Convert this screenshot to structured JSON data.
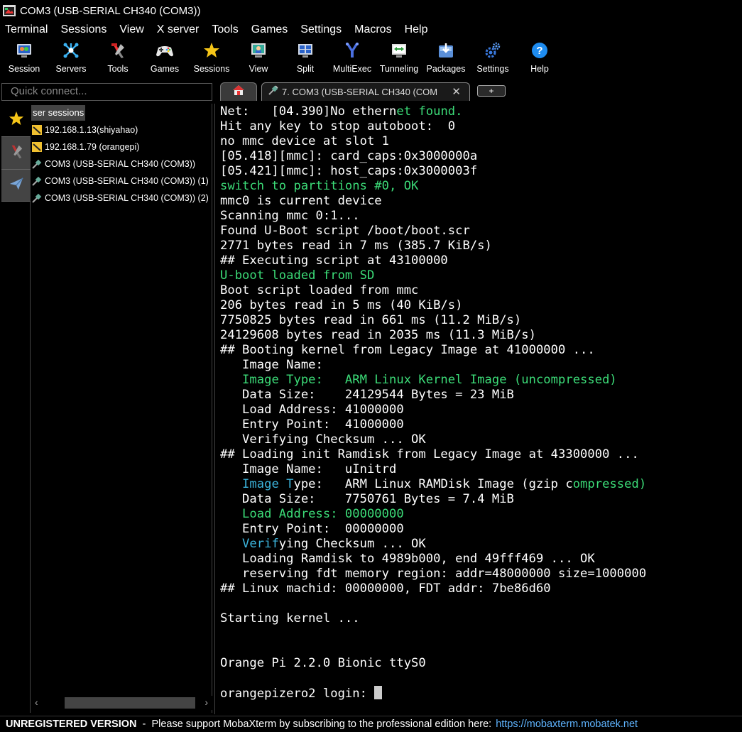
{
  "window": {
    "title": "COM3  (USB-SERIAL CH340 (COM3))"
  },
  "menu": [
    "Terminal",
    "Sessions",
    "View",
    "X server",
    "Tools",
    "Games",
    "Settings",
    "Macros",
    "Help"
  ],
  "toolbar": [
    {
      "label": "Session",
      "icon": "session-icon"
    },
    {
      "label": "Servers",
      "icon": "servers-icon"
    },
    {
      "label": "Tools",
      "icon": "tools-icon"
    },
    {
      "label": "Games",
      "icon": "gamepad-icon"
    },
    {
      "label": "Sessions",
      "icon": "star-icon"
    },
    {
      "label": "View",
      "icon": "view-icon"
    },
    {
      "label": "Split",
      "icon": "split-icon"
    },
    {
      "label": "MultiExec",
      "icon": "multiexec-icon"
    },
    {
      "label": "Tunneling",
      "icon": "tunneling-icon"
    },
    {
      "label": "Packages",
      "icon": "packages-icon"
    },
    {
      "label": "Settings",
      "icon": "settings-icon"
    },
    {
      "label": "Help",
      "icon": "help-icon"
    }
  ],
  "quick_connect": {
    "placeholder": "Quick connect..."
  },
  "tabs": {
    "active_label": "7. COM3  (USB-SERIAL CH340 (COM",
    "close": "✕",
    "add": "+"
  },
  "sessions_panel": {
    "header": "ser sessions",
    "items": [
      {
        "label": "192.168.1.13(shiyahao)",
        "icon": "ssh-session-icon"
      },
      {
        "label": "192.168.1.79 (orangepi)",
        "icon": "ssh-session-icon"
      },
      {
        "label": "COM3  (USB-SERIAL CH340 (COM3))",
        "icon": "serial-session-icon"
      },
      {
        "label": "COM3  (USB-SERIAL CH340 (COM3)) (1)",
        "icon": "serial-session-icon"
      },
      {
        "label": "COM3  (USB-SERIAL CH340 (COM3)) (2)",
        "icon": "serial-session-icon"
      }
    ]
  },
  "terminal_lines": [
    [
      [
        "Net:   [04.390]No ethern",
        ""
      ],
      [
        "et found.",
        "g"
      ]
    ],
    [
      [
        "Hit any key to stop autoboot:  0",
        ""
      ]
    ],
    [
      [
        "no mmc device at slot 1",
        ""
      ]
    ],
    [
      [
        "[05.418][mmc]: card_caps:0x3000000a",
        ""
      ]
    ],
    [
      [
        "[05.421][mmc]: host_caps:0x3000003f",
        ""
      ]
    ],
    [
      [
        "switch to partitions #0, OK",
        "g"
      ]
    ],
    [
      [
        "mmc0 is current device",
        ""
      ]
    ],
    [
      [
        "Scanning mmc 0:1...",
        ""
      ]
    ],
    [
      [
        "Found U-Boot script /boot/boot.scr",
        ""
      ]
    ],
    [
      [
        "2771 bytes read in 7 ms (385.7 KiB/s)",
        ""
      ]
    ],
    [
      [
        "## Executing script at 43100000",
        ""
      ]
    ],
    [
      [
        "U-boot loaded from SD",
        "g"
      ]
    ],
    [
      [
        "Boot script loaded from mmc",
        ""
      ]
    ],
    [
      [
        "206 bytes read in 5 ms (40 KiB/s)",
        ""
      ]
    ],
    [
      [
        "7750825 bytes read in 661 ms (11.2 MiB/s)",
        ""
      ]
    ],
    [
      [
        "24129608 bytes read in 2035 ms (11.3 MiB/s)",
        ""
      ]
    ],
    [
      [
        "## Booting kernel from Legacy Image at 41000000 ...",
        ""
      ]
    ],
    [
      [
        "   Image Name:",
        ""
      ]
    ],
    [
      [
        "   ",
        ""
      ],
      [
        "Image Type:   ARM Linux Kernel Image (uncompressed)",
        "g"
      ]
    ],
    [
      [
        "   Data Size:    24129544 Bytes = 23 MiB",
        ""
      ]
    ],
    [
      [
        "   Load Address: 41000000",
        ""
      ]
    ],
    [
      [
        "   Entry Point:  41000000",
        ""
      ]
    ],
    [
      [
        "   Verifying Checksum ... OK",
        ""
      ]
    ],
    [
      [
        "## Loading init Ramdisk from Legacy Image at 43300000 ...",
        ""
      ]
    ],
    [
      [
        "   Image Name:   uInitrd",
        ""
      ]
    ],
    [
      [
        "   ",
        ""
      ],
      [
        "Image T",
        "b"
      ],
      [
        "ype:   ARM Linux RAMDisk Image (gzip c",
        ""
      ],
      [
        "ompressed)",
        "g"
      ]
    ],
    [
      [
        "   Data Size:    7750761 Bytes = 7.4 MiB",
        ""
      ]
    ],
    [
      [
        "   ",
        ""
      ],
      [
        "Load Address: 00000000",
        "g"
      ]
    ],
    [
      [
        "   Entry Point:  00000000",
        ""
      ]
    ],
    [
      [
        "   ",
        ""
      ],
      [
        "Verif",
        "b"
      ],
      [
        "ying Checksum ... OK",
        ""
      ]
    ],
    [
      [
        "   Loading Ramdisk to 4989b000, end 49fff469 ... OK",
        ""
      ]
    ],
    [
      [
        "   reserving fdt memory region: addr=48000000 size=1000000",
        ""
      ]
    ],
    [
      [
        "## Linux machid: 00000000, FDT addr: 7be86d60",
        ""
      ]
    ],
    [
      [
        "",
        ""
      ]
    ],
    [
      [
        "Starting kernel ...",
        ""
      ]
    ],
    [
      [
        "",
        ""
      ]
    ],
    [
      [
        "",
        ""
      ]
    ],
    [
      [
        "Orange Pi 2.2.0 Bionic ttyS0",
        ""
      ]
    ],
    [
      [
        "",
        ""
      ]
    ],
    [
      [
        "orangepizero2 login: ",
        ""
      ]
    ]
  ],
  "status": {
    "unregistered": "UNREGISTERED VERSION",
    "message": "  -  Please support MobaXterm by subscribing to the professional edition here:",
    "link": "https://mobaxterm.mobatek.net"
  },
  "colors": {
    "terminal_green": "#3cdc78",
    "terminal_blue": "#3cb4dc",
    "link": "#5fb4ff"
  }
}
